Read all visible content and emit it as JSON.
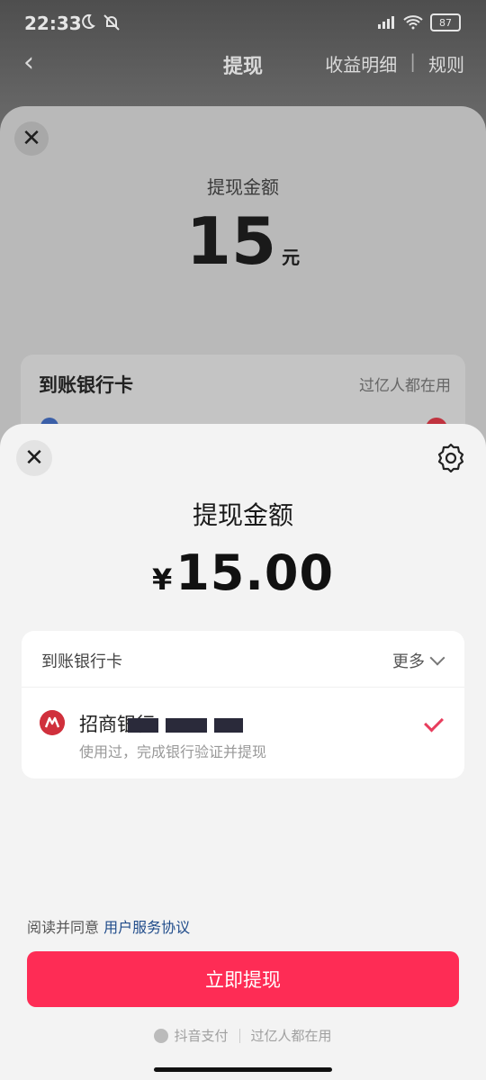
{
  "status": {
    "time": "22:33",
    "battery": "87"
  },
  "appbar": {
    "title": "提现",
    "earnings": "收益明细",
    "rules": "规则"
  },
  "background_sheet": {
    "label": "提现金额",
    "amount": "15",
    "unit": "元",
    "card_title": "到账银行卡",
    "card_right": "过亿人都在用"
  },
  "sheet": {
    "title": "提现金额",
    "currency": "¥",
    "amount": "15.00",
    "card": {
      "header": "到账银行卡",
      "more": "更多",
      "bank_name": "招商银行",
      "bank_sub": "使用过，完成银行验证并提现"
    },
    "agree_prefix": "阅读并同意",
    "agree_link": "用户服务协议",
    "submit": "立即提现",
    "footer_brand": "抖音支付",
    "footer_slogan": "过亿人都在用"
  },
  "colors": {
    "accent": "#fe2c55",
    "link": "#1f4b8a",
    "check": "#e83d5d"
  },
  "icons": [
    "back-arrow-icon",
    "close-icon",
    "gear-icon",
    "chevron-down-icon",
    "checkmark-icon",
    "bank-logo-icon",
    "douyin-pay-logo-icon"
  ]
}
